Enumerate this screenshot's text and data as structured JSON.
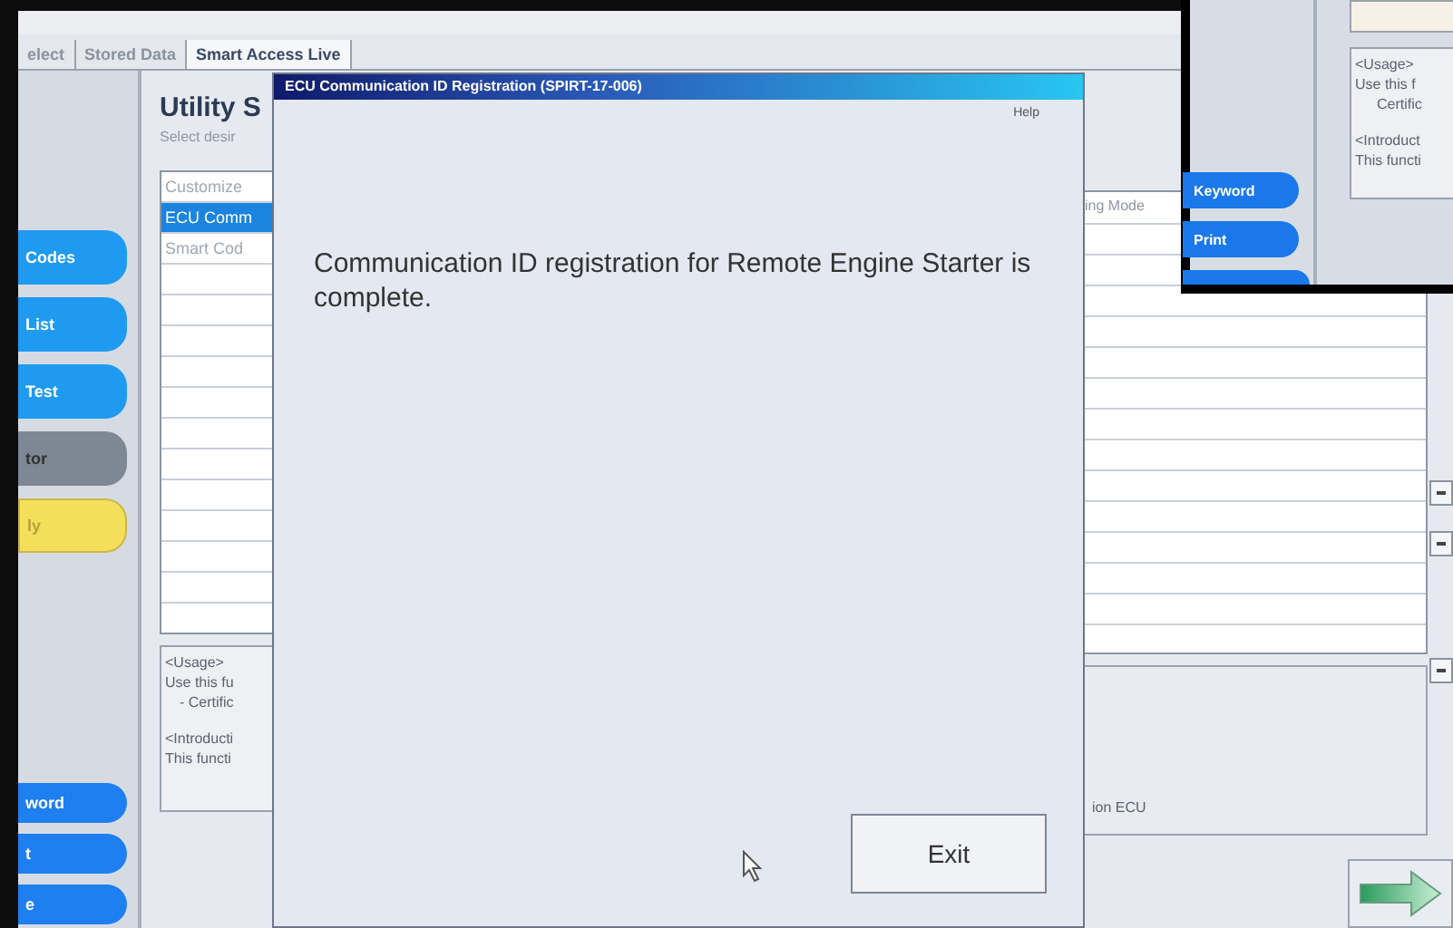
{
  "tabs": [
    {
      "label": "elect",
      "selected": false
    },
    {
      "label": "Stored Data",
      "selected": false
    },
    {
      "label": "Smart Access Live",
      "selected": true
    }
  ],
  "sidebar": {
    "buttons": [
      {
        "label": "Codes",
        "kind": "blue"
      },
      {
        "label": "List",
        "kind": "blue"
      },
      {
        "label": "Test",
        "kind": "blue"
      },
      {
        "label": "tor",
        "kind": "gray"
      },
      {
        "label": "ly",
        "kind": "yellow"
      }
    ],
    "bottom_buttons": [
      {
        "label": "word"
      },
      {
        "label": "t"
      },
      {
        "label": "e"
      }
    ]
  },
  "utility": {
    "title": "Utility S",
    "subtitle": "Select desir",
    "list": {
      "header": "ing Mode",
      "rows": [
        {
          "label": "Customize",
          "selected": false
        },
        {
          "label": "ECU Comm",
          "selected": true
        },
        {
          "label": "Smart Cod",
          "selected": false
        }
      ]
    },
    "description": [
      [
        {
          "text": "<Usage>",
          "kind": "plain"
        },
        {
          "text": "Use this fu",
          "kind": "plain"
        },
        {
          "text": "- Certific",
          "kind": "bullet"
        }
      ],
      [
        {
          "text": "<Introducti",
          "kind": "plain"
        },
        {
          "text": "This functi",
          "kind": "plain"
        }
      ]
    ],
    "description_tail": "ion ECU"
  },
  "dialog": {
    "title": "ECU Communication ID Registration (SPIRT-17-006)",
    "menu": "Help",
    "message": "Communication ID registration for Remote Engine Starter is complete.",
    "button": "Exit"
  },
  "inset": {
    "description": [
      [
        {
          "text": "<Usage>",
          "kind": "plain"
        },
        {
          "text": "Use this f",
          "kind": "plain"
        },
        {
          "text": "Certific",
          "kind": "bullet"
        }
      ],
      [
        {
          "text": "<Introduct",
          "kind": "plain"
        },
        {
          "text": "This functi",
          "kind": "plain"
        }
      ]
    ],
    "buttons": [
      {
        "label": "Keyword"
      },
      {
        "label": "Print"
      }
    ]
  }
}
